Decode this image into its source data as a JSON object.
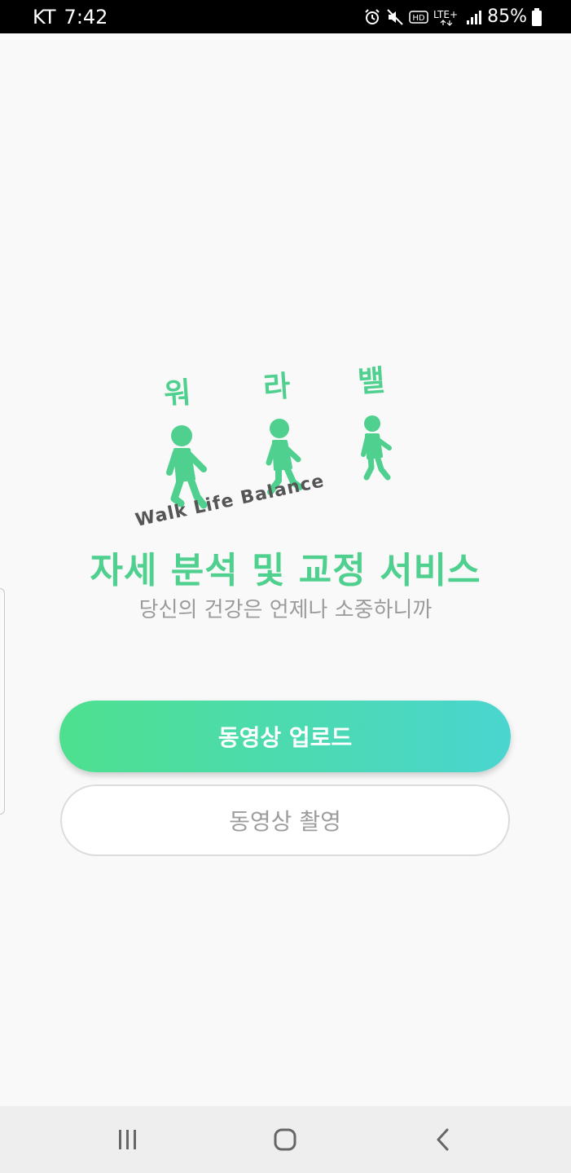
{
  "status_bar": {
    "carrier": "KT",
    "time": "7:42",
    "battery": "85%",
    "icons": [
      "alarm-icon",
      "mute-icon",
      "hd-icon",
      "lte-icon",
      "signal-icon",
      "battery-icon"
    ]
  },
  "logo": {
    "chars": [
      "워",
      "라",
      "밸"
    ],
    "tagline": "Walk Life Balance",
    "color": "#4fd08f"
  },
  "main": {
    "title": "자세 분석 및 교정 서비스",
    "subtitle": "당신의 건강은 언제나 소중하니까"
  },
  "buttons": {
    "upload_label": "동영상 업로드",
    "record_label": "동영상 촬영"
  },
  "nav": {
    "icons": [
      "recent-apps-icon",
      "home-icon",
      "back-icon"
    ]
  },
  "colors": {
    "accent": "#4fd08f",
    "gradient_start": "#4ee08f",
    "gradient_end": "#4ad5cf"
  }
}
